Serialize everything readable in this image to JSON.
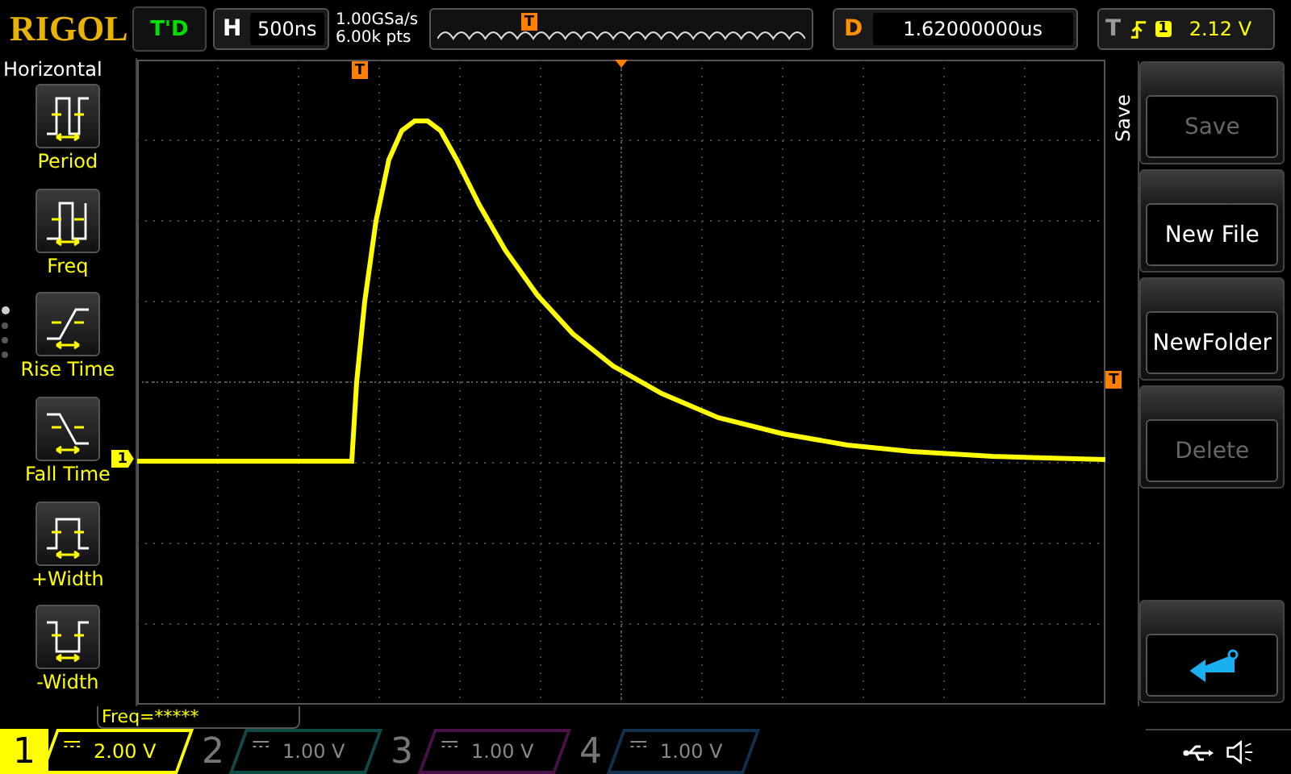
{
  "header": {
    "logo": "RIGOL",
    "run_status": "T'D",
    "timebase": {
      "label": "H",
      "value": "500ns"
    },
    "sample_rate": "1.00GSa/s",
    "memory_depth": "6.00k pts",
    "memory_marker": "T",
    "delay": {
      "label": "D",
      "value": "1.62000000us"
    },
    "trigger": {
      "label": "T",
      "source": "1",
      "level": "2.12 V"
    }
  },
  "measure_menu": {
    "title": "Horizontal",
    "items": [
      {
        "label": "Period",
        "kind": "period"
      },
      {
        "label": "Freq",
        "kind": "freq"
      },
      {
        "label": "Rise Time",
        "kind": "rise"
      },
      {
        "label": "Fall Time",
        "kind": "fall"
      },
      {
        "label": "+Width",
        "kind": "pwidth"
      },
      {
        "label": "-Width",
        "kind": "nwidth"
      }
    ],
    "pages": [
      {
        "selected": true
      },
      {
        "selected": false
      },
      {
        "selected": false
      },
      {
        "selected": false
      }
    ]
  },
  "scope": {
    "trigger_position_marker": "T",
    "trigger_level_marker": "T",
    "channel_marker": "1"
  },
  "softkey_menu": {
    "title": "Save",
    "buttons": [
      {
        "label": "Save",
        "disabled": true
      },
      {
        "label": "New File",
        "disabled": false
      },
      {
        "label": "NewFolder",
        "disabled": false
      },
      {
        "label": "Delete",
        "disabled": true
      }
    ]
  },
  "readout": "Freq=*****",
  "channels": [
    {
      "number": "1",
      "scale": "2.00 V",
      "selected": true,
      "color": "#ffff00"
    },
    {
      "number": "2",
      "scale": "1.00 V",
      "selected": false,
      "color": "#0f4a46"
    },
    {
      "number": "3",
      "scale": "1.00 V",
      "selected": false,
      "color": "#4a1048"
    },
    {
      "number": "4",
      "scale": "1.00 V",
      "selected": false,
      "color": "#10304e"
    }
  ]
}
